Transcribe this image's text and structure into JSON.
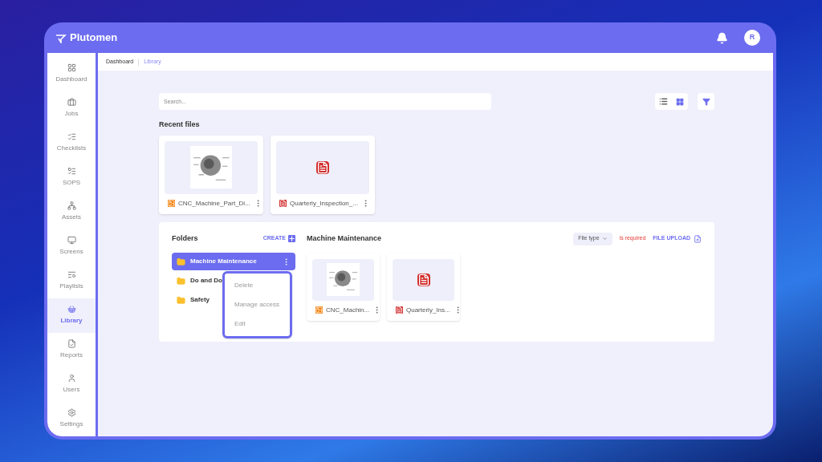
{
  "app": {
    "brand": "Plutomen",
    "avatar": "R"
  },
  "sidebar": {
    "items": [
      {
        "label": "Dashboard",
        "selected": false
      },
      {
        "label": "Jobs",
        "selected": false
      },
      {
        "label": "Checklists",
        "selected": false
      },
      {
        "label": "SOPS",
        "selected": false
      },
      {
        "label": "Assets",
        "selected": false
      },
      {
        "label": "Screens",
        "selected": false
      },
      {
        "label": "Playlists",
        "selected": false
      },
      {
        "label": "Library",
        "selected": true
      },
      {
        "label": "Reports",
        "selected": false
      },
      {
        "label": "Users",
        "selected": false
      },
      {
        "label": "Settings",
        "selected": false
      }
    ]
  },
  "breadcrumb": [
    {
      "label": "Dashboard",
      "selected": false
    },
    {
      "label": "Library",
      "selected": true
    }
  ],
  "search": {
    "placeholder": "Search..."
  },
  "view_toggle": [
    {
      "kind": "list",
      "selected": false
    },
    {
      "kind": "grid",
      "selected": true
    }
  ],
  "recent_files": {
    "title": "Recent files",
    "files": [
      {
        "name": "CNC_Machine_Part_Di...",
        "kind": "image"
      },
      {
        "name": "Quarterly_Inspection_...",
        "kind": "pdf"
      }
    ]
  },
  "folders": {
    "title": "Folders",
    "create": "CREATE",
    "items": [
      {
        "name": "Machine Maintenance",
        "selected": true
      },
      {
        "name": "Do and Do",
        "selected": false
      },
      {
        "name": "Safety",
        "selected": false
      }
    ],
    "menu": [
      "Delete",
      "Manage access",
      "Edit"
    ]
  },
  "folder_view": {
    "title": "Machine Maintenance",
    "file_type": "File type",
    "error": "is required",
    "upload": "FILE UPLOAD",
    "files": [
      {
        "name": "CNC_Machin...",
        "kind": "image"
      },
      {
        "name": "Quarterly_Ins...",
        "kind": "pdf"
      }
    ]
  }
}
